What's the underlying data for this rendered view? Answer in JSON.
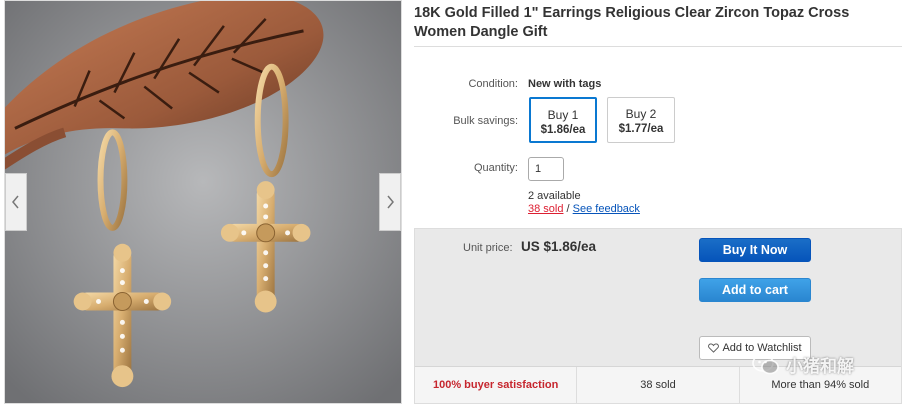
{
  "title": "18K Gold Filled 1\" Earrings Religious Clear Zircon Topaz Cross Women Dangle Gift",
  "gallery": {
    "prev_icon": "chevron-left-icon",
    "next_icon": "chevron-right-icon"
  },
  "details": {
    "condition_label": "Condition:",
    "condition_value": "New with tags",
    "bulk_label": "Bulk savings:",
    "bulk_options": [
      {
        "qty": "Buy 1",
        "price": "$1.86/ea",
        "selected": true
      },
      {
        "qty": "Buy 2",
        "price": "$1.77/ea",
        "selected": false
      }
    ],
    "quantity_label": "Quantity:",
    "quantity_value": "1",
    "available": "2 available",
    "sold": "38 sold",
    "sold_separator": " / ",
    "feedback": "See feedback"
  },
  "purchase": {
    "unit_label": "Unit price:",
    "unit_price": "US $1.86/ea",
    "buy_now": "Buy It Now",
    "add_to_cart": "Add to cart",
    "watchlist": "Add to Watchlist",
    "watchlist_icon": "heart-outline-icon"
  },
  "stats": [
    "100% buyer satisfaction",
    "38 sold",
    "More than 94% sold"
  ],
  "watermark": {
    "text": "小猪和解",
    "icon": "wechat-icon"
  },
  "colors": {
    "buy_now": "#0654ba",
    "add_to_cart": "#2a86d0",
    "sold_link": "#dd1e31",
    "feedback_link": "#0654ba",
    "satisfaction": "#c6262e"
  }
}
